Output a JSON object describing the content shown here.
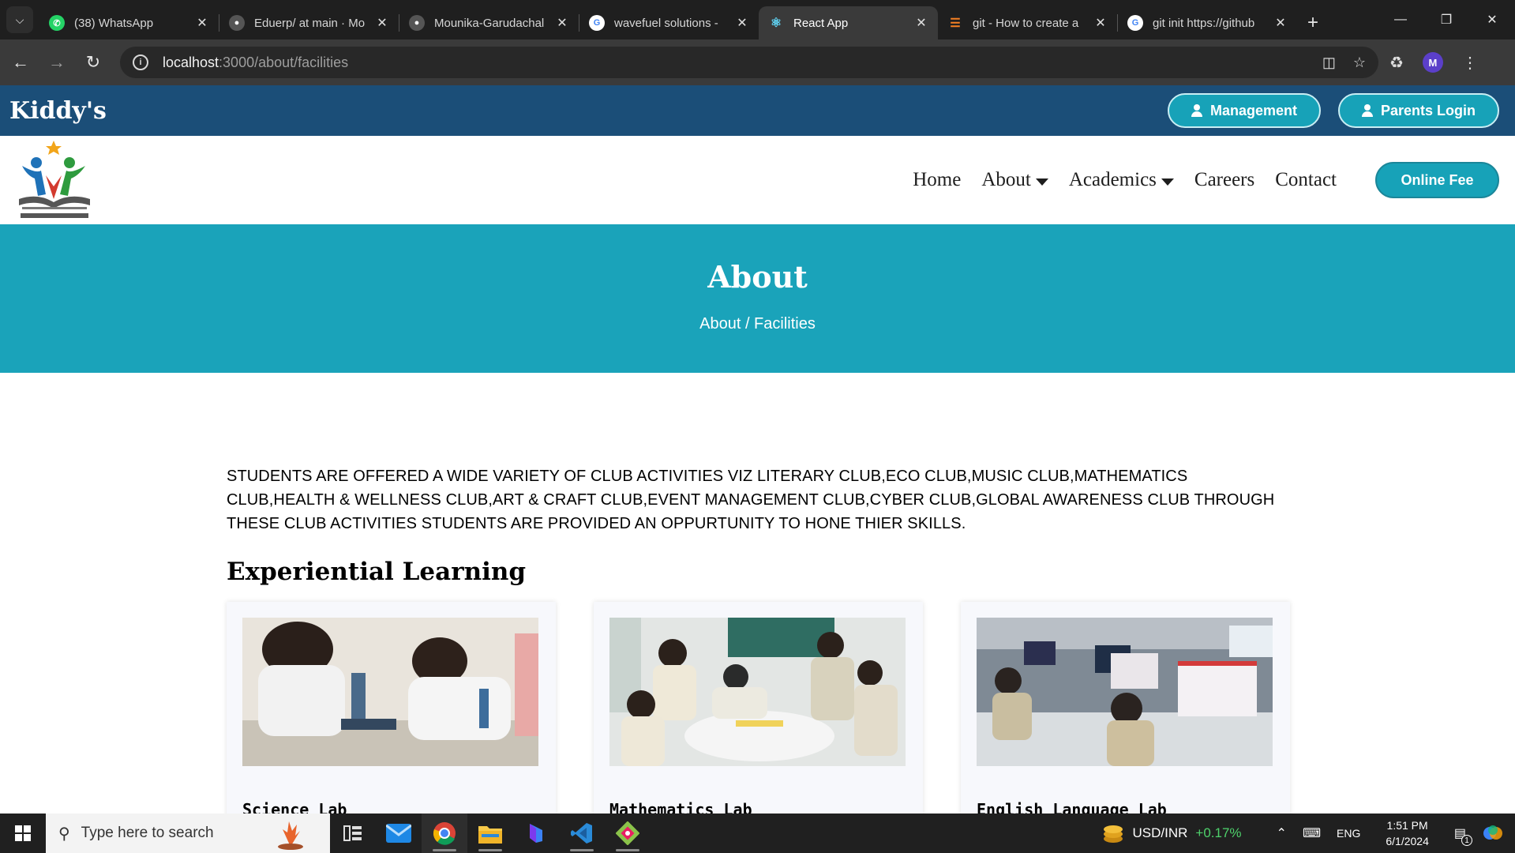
{
  "browser": {
    "tabs": [
      {
        "title": "(38) WhatsApp",
        "favicon": "whatsapp-icon",
        "color": "#25d366"
      },
      {
        "title": "Eduerp/ at main · Mo",
        "favicon": "github-icon",
        "color": "#444444"
      },
      {
        "title": "Mounika-Garudachal",
        "favicon": "github-icon",
        "color": "#444444"
      },
      {
        "title": "wavefuel solutions - ",
        "favicon": "google-icon",
        "color": "#4285f4"
      },
      {
        "title": "React App",
        "favicon": "react-icon",
        "color": "#61dafb",
        "active": true
      },
      {
        "title": "git - How to create a",
        "favicon": "stackoverflow-icon",
        "color": "#f48024"
      },
      {
        "title": "git init https://github",
        "favicon": "google-icon",
        "color": "#4285f4"
      }
    ],
    "url_host": "localhost",
    "url_path": ":3000/about/facilities",
    "profile_initial": "M"
  },
  "site": {
    "brand": "Kiddy's",
    "top_buttons": {
      "management": "Management",
      "parents_login": "Parents Login"
    },
    "nav": {
      "home": "Home",
      "about": "About",
      "academics": "Academics",
      "careers": "Careers",
      "contact": "Contact"
    },
    "online_fee": "Online Fee",
    "accent": "#17a2b8",
    "topbar_color": "#1b4e78"
  },
  "banner": {
    "title": "About",
    "breadcrumb": "About / Facilities"
  },
  "content": {
    "intro": "STUDENTS ARE OFFERED A WIDE VARIETY OF CLUB ACTIVITIES VIZ LITERARY CLUB,ECO CLUB,MUSIC CLUB,MATHEMATICS CLUB,HEALTH & WELLNESS CLUB,ART & CRAFT CLUB,EVENT MANAGEMENT CLUB,CYBER CLUB,GLOBAL AWARENESS CLUB THROUGH THESE CLUB ACTIVITIES STUDENTS ARE PROVIDED AN OPPURTUNITY TO HONE THIER SKILLS.",
    "section_title": "Experiential Learning",
    "cards": [
      {
        "title": "Science Lab"
      },
      {
        "title": "Mathematics Lab"
      },
      {
        "title": "English Language Lab"
      }
    ]
  },
  "taskbar": {
    "search_placeholder": "Type here to search",
    "stock_label": "USD/INR",
    "stock_change": "+0.17%",
    "language": "ENG",
    "time": "1:51 PM",
    "date": "6/1/2024",
    "notification_count": "1"
  }
}
